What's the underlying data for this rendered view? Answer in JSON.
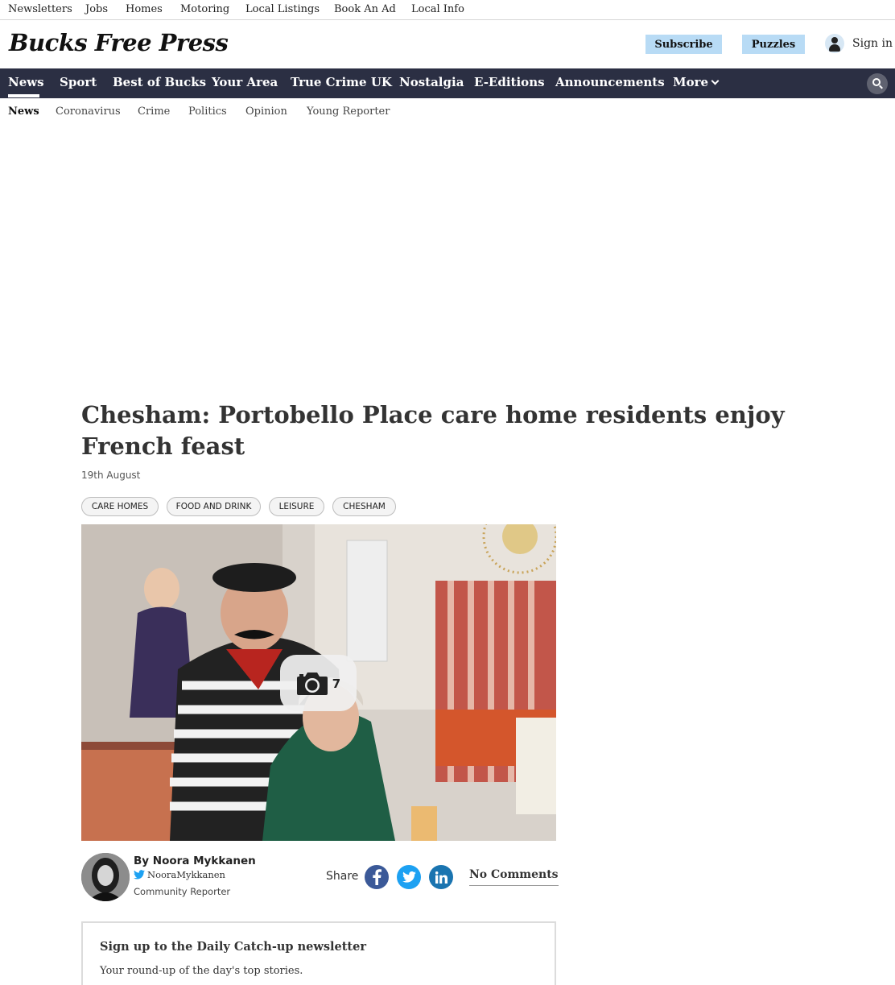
{
  "utility_nav": {
    "items": [
      "Newsletters",
      "Jobs",
      "Homes",
      "Motoring",
      "Local Listings",
      "Book An Ad",
      "Local Info"
    ]
  },
  "masthead": {
    "logo": "Bucks Free Press",
    "subscribe_label": "Subscribe",
    "puzzles_label": "Puzzles",
    "signin_label": "Sign in"
  },
  "main_nav": {
    "items": [
      "News",
      "Sport",
      "Best of Bucks",
      "Your Area",
      "True Crime UK",
      "Nostalgia",
      "E-Editions",
      "Announcements",
      "More"
    ],
    "active": "News"
  },
  "sub_nav": {
    "items": [
      "News",
      "Coronavirus",
      "Crime",
      "Politics",
      "Opinion",
      "Young Reporter"
    ],
    "active": "News"
  },
  "article": {
    "headline": "Chesham: Portobello Place care home residents enjoy French feast",
    "date": "19th August",
    "tags": [
      "CARE HOMES",
      "FOOD AND DRINK",
      "LEISURE",
      "CHESHAM"
    ],
    "gallery_count": "7"
  },
  "byline": {
    "author": "By Noora Mykkanen",
    "twitter": "NooraMykkanen",
    "role": "Community Reporter",
    "share_label": "Share",
    "comments_label": "No Comments"
  },
  "newsletter": {
    "title": "Sign up to the Daily Catch-up newsletter",
    "description": "Your round-up of the day's top stories."
  },
  "colors": {
    "nav_background": "#2b2f43",
    "button_background": "#b8dbf5",
    "facebook": "#3b5998",
    "twitter": "#1da1f2",
    "linkedin": "#1a74b0"
  }
}
